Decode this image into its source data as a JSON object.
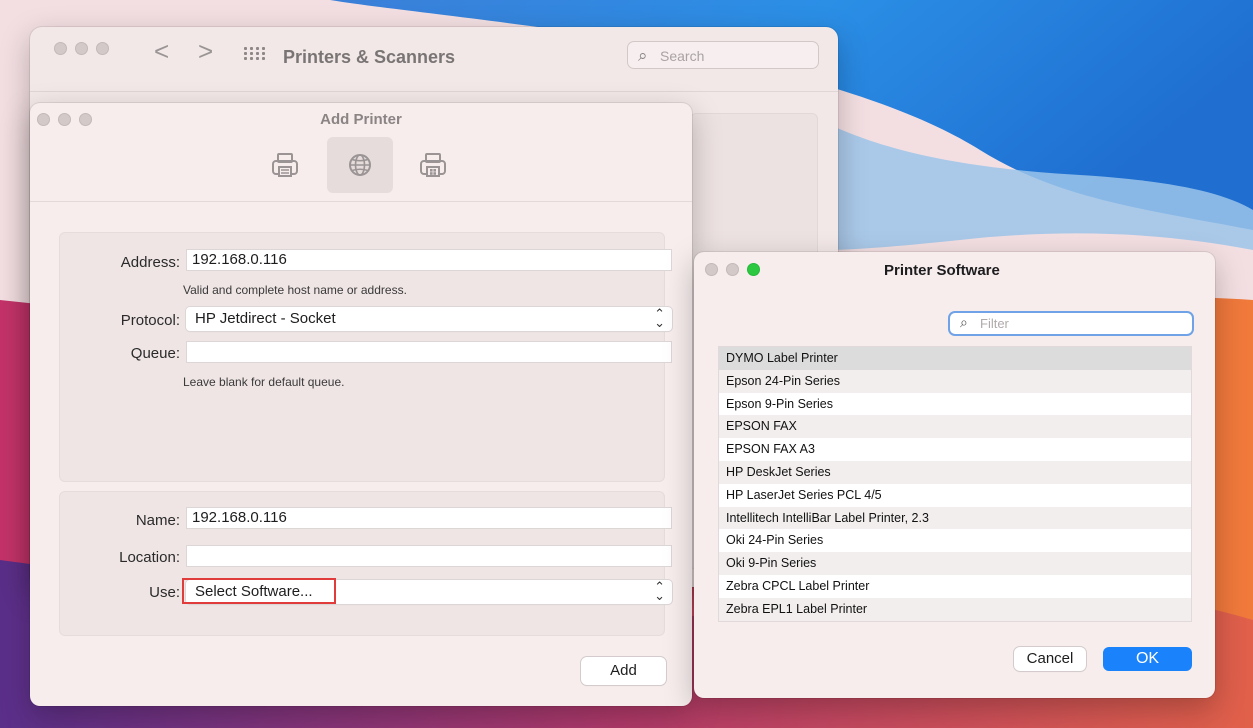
{
  "printers_window": {
    "title": "Printers & Scanners",
    "search_placeholder": "Search",
    "back_glyph": "<",
    "forward_glyph": ">"
  },
  "add_printer": {
    "title": "Add Printer",
    "toolbar": [
      "default-printer-icon",
      "ip-globe-icon",
      "windows-printer-icon"
    ],
    "address_label": "Address:",
    "address_value": "192.168.0.116",
    "address_hint": "Valid and complete host name or address.",
    "protocol_label": "Protocol:",
    "protocol_value": "HP Jetdirect - Socket",
    "queue_label": "Queue:",
    "queue_value": "",
    "queue_hint": "Leave blank for default queue.",
    "name_label": "Name:",
    "name_value": "192.168.0.116",
    "location_label": "Location:",
    "location_value": "",
    "use_label": "Use:",
    "use_value": "Select Software...",
    "add_button": "Add"
  },
  "printer_software": {
    "title": "Printer Software",
    "filter_placeholder": "Filter",
    "items": [
      "DYMO Label Printer",
      "Epson 24-Pin Series",
      "Epson 9-Pin Series",
      "EPSON FAX",
      "EPSON FAX A3",
      "HP DeskJet Series",
      "HP LaserJet Series PCL 4/5",
      "Intellitech IntelliBar Label Printer, 2.3",
      "Oki 24-Pin Series",
      "Oki 9-Pin Series",
      "Zebra CPCL Label Printer",
      "Zebra EPL1 Label Printer"
    ],
    "selected_index": 0,
    "cancel_button": "Cancel",
    "ok_button": "OK"
  },
  "colors": {
    "accent": "#1a82fb",
    "highlight_border": "#e03c3c",
    "traffic_green": "#2bc840"
  }
}
